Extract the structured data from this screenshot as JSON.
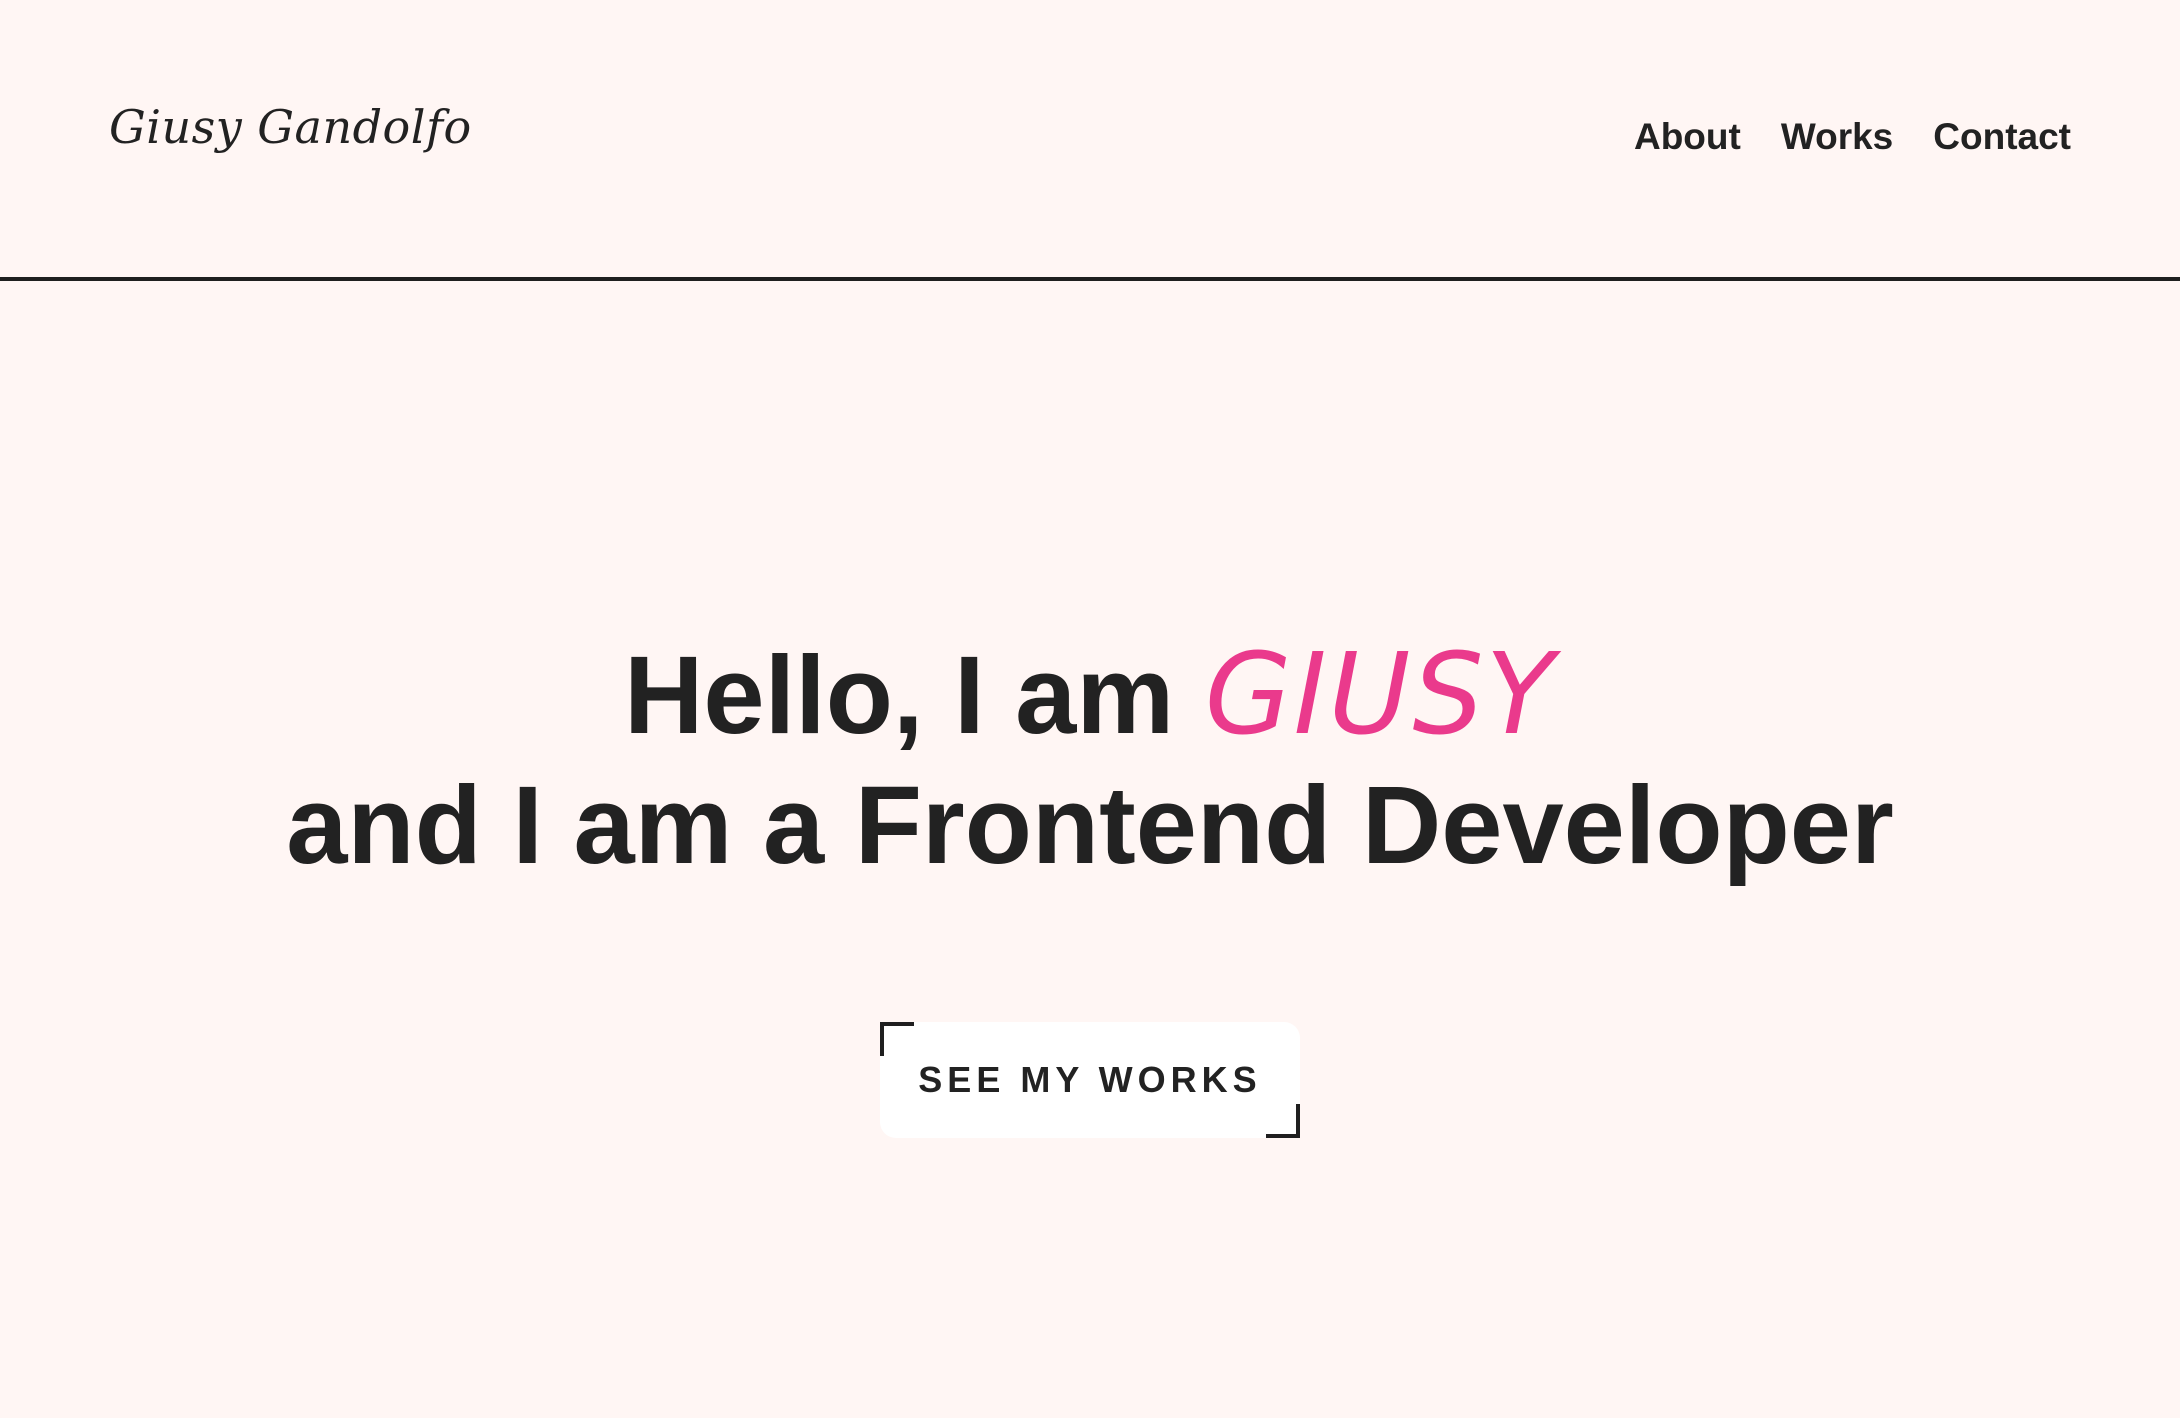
{
  "header": {
    "logo": "Giusy Gandolfo",
    "nav": [
      {
        "label": "About"
      },
      {
        "label": "Works"
      },
      {
        "label": "Contact"
      }
    ]
  },
  "hero": {
    "line1_prefix": "Hello, I am ",
    "name": "GIUSY",
    "line2": "and I am a Frontend Developer",
    "cta_label": "SEE MY WORKS"
  },
  "colors": {
    "background": "#fff6f4",
    "text": "#222222",
    "accent": "#ea3a8c",
    "button_bg": "#ffffff"
  }
}
